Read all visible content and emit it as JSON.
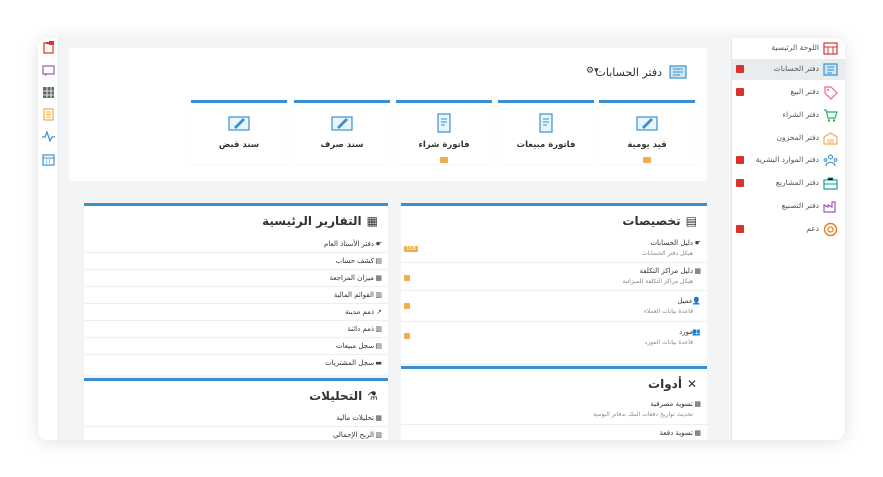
{
  "sidebar": {
    "items": [
      {
        "label": "اللوحة الرئيسية",
        "icon": "dashboard-icon",
        "badge": false,
        "active": false
      },
      {
        "label": "دفتر الحسابات",
        "icon": "ledger-icon",
        "badge": true,
        "active": true
      },
      {
        "label": "دفتر البيع",
        "icon": "tag-icon",
        "badge": true,
        "active": false
      },
      {
        "label": "دفتر الشراء",
        "icon": "cart-icon",
        "badge": false,
        "active": false
      },
      {
        "label": "دفتر المخزون",
        "icon": "warehouse-icon",
        "badge": false,
        "active": false
      },
      {
        "label": "دفتر الموارد البشرية",
        "icon": "people-icon",
        "badge": true,
        "active": false
      },
      {
        "label": "دفتر المشاريع",
        "icon": "briefcase-icon",
        "badge": true,
        "active": false
      },
      {
        "label": "دفتر التصنيع",
        "icon": "factory-icon",
        "badge": false,
        "active": false
      },
      {
        "label": "دعم",
        "icon": "lifebuoy-icon",
        "badge": true,
        "active": false
      }
    ]
  },
  "strip": {
    "icons": [
      "clipboard-icon",
      "chat-icon",
      "grid-icon",
      "notes-icon",
      "pulse-icon",
      "calendar-icon"
    ]
  },
  "header": {
    "title": "دفتر الحسابات",
    "gear": "⚙▾"
  },
  "tiles": [
    {
      "label": "قيد يومية",
      "badge": true
    },
    {
      "label": "فاتورة مبيعات",
      "badge": false
    },
    {
      "label": "فاتورة شراء",
      "badge": true
    },
    {
      "label": "سند صرف",
      "badge": false
    },
    {
      "label": "سند قبض",
      "badge": false
    }
  ],
  "allocations": {
    "title": "تخصيصات",
    "rows": [
      {
        "label": "دليل الحسابات",
        "sub": "هيكل دفتر الحسابات",
        "badge": "158",
        "icon": "☛"
      },
      {
        "label": "دليل مراكز التكلفة",
        "sub": "هيكل مراكز التكلفة للميزانية",
        "badge": "5",
        "icon": "▦"
      },
      {
        "label": "عميل",
        "sub": "قاعدة بيانات العملاء",
        "badge": "5",
        "icon": "👤"
      },
      {
        "label": "مورد",
        "sub": "قاعدة بيانات المورد",
        "badge": "5",
        "icon": "👥"
      }
    ]
  },
  "tools": {
    "title": "أدوات",
    "rows": [
      {
        "label": "تسوية مصرفية",
        "sub": "تحديث تواريخ دفعات البنك بدفاتر اليومية",
        "icon": "▦"
      },
      {
        "label": "تسوية دفعة",
        "sub": "",
        "icon": "▦"
      }
    ]
  },
  "reports": {
    "title": "التقارير الرئيسية",
    "rows": [
      {
        "label": "دفتر الأستاذ العام",
        "icon": "☛"
      },
      {
        "label": "كشف حساب",
        "icon": "▤"
      },
      {
        "label": "ميزان المراجعة",
        "icon": "▦"
      },
      {
        "label": "القوائم المالية",
        "icon": "▥"
      },
      {
        "label": "ذمم مدينة",
        "icon": "↗"
      },
      {
        "label": "ذمم دائنة",
        "icon": "▥"
      },
      {
        "label": "سجل مبيعات",
        "icon": "▤"
      },
      {
        "label": "سجل المشتريات",
        "icon": "▬"
      }
    ]
  },
  "analytics": {
    "title": "التحليلات",
    "rows": [
      {
        "label": "تحليلات مالية",
        "icon": "▦"
      },
      {
        "label": "الربح الإجمالي",
        "icon": "▥"
      }
    ]
  },
  "colors": {
    "accent": "#3a8fd0",
    "badge_red": "#d9342b",
    "badge_orange": "#f0ad4e"
  }
}
